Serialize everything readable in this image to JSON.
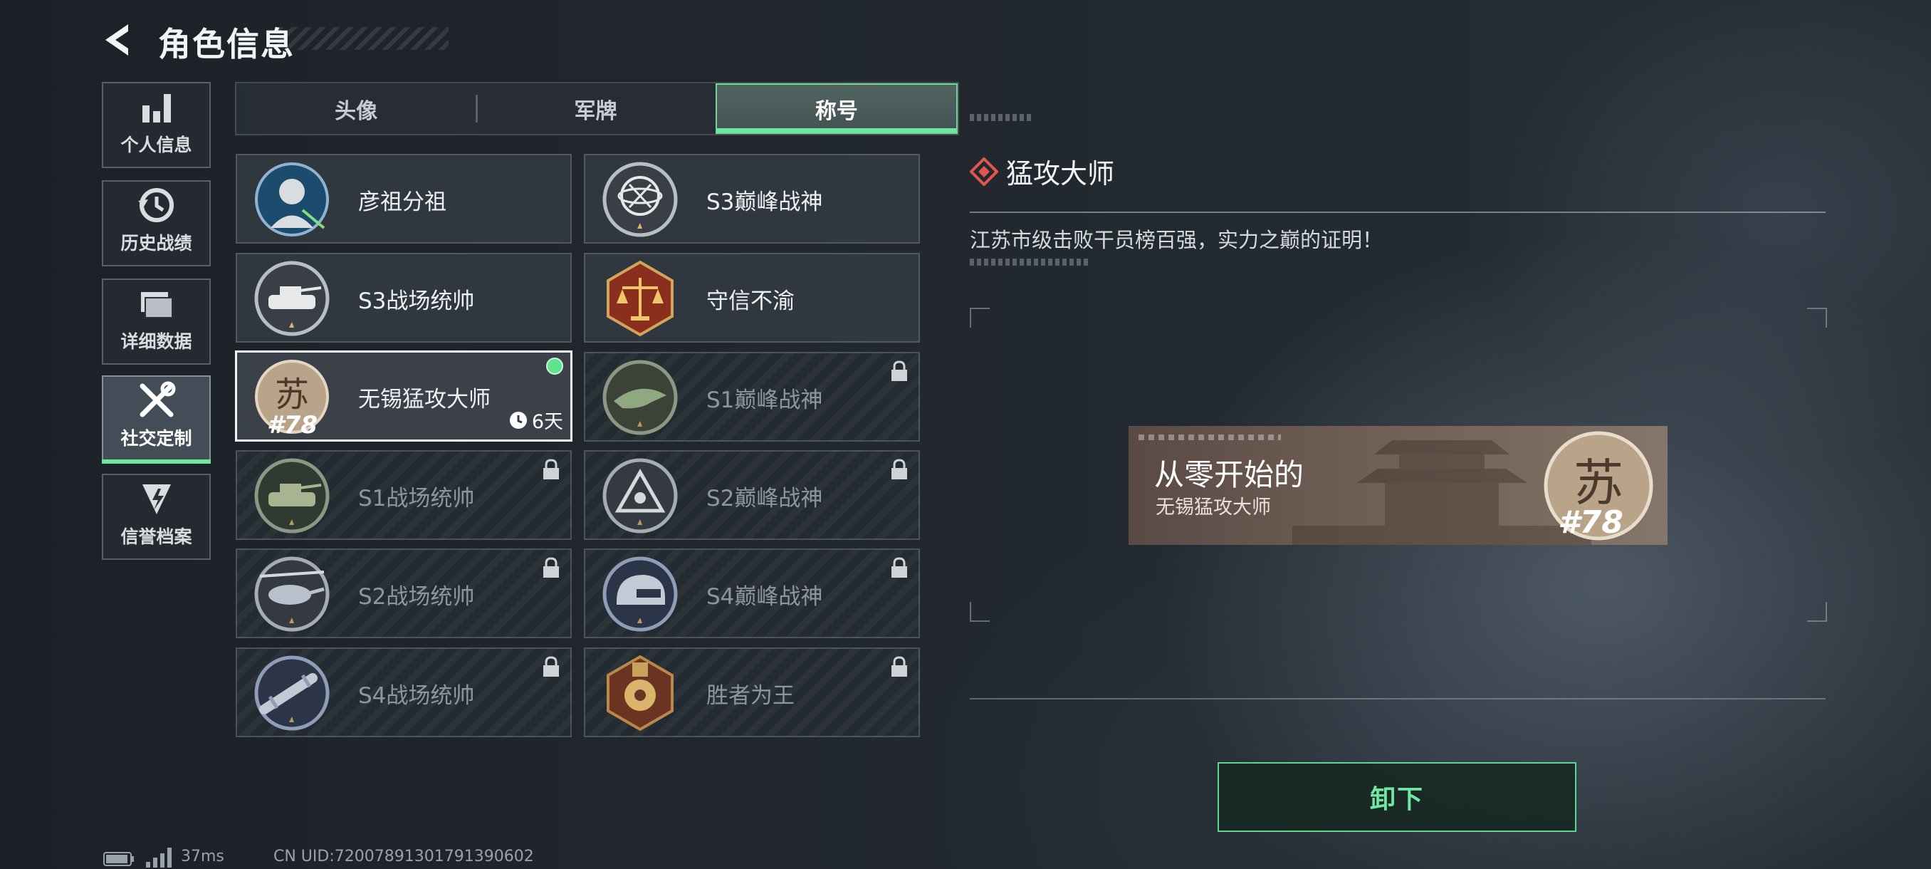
{
  "header": {
    "title": "角色信息"
  },
  "nav": {
    "items": [
      {
        "label": "个人信息",
        "icon": "bar-chart-icon"
      },
      {
        "label": "历史战绩",
        "icon": "history-icon"
      },
      {
        "label": "详细数据",
        "icon": "folder-icon"
      },
      {
        "label": "社交定制",
        "icon": "tools-icon",
        "active": true
      },
      {
        "label": "信誉档案",
        "icon": "shield-bolt-icon"
      }
    ]
  },
  "tabs": [
    {
      "label": "头像"
    },
    {
      "label": "军牌"
    },
    {
      "label": "称号",
      "active": true
    }
  ],
  "titles": [
    {
      "label": "彦祖分祖",
      "icon": "portrait-badge-icon",
      "locked": false
    },
    {
      "label": "S3巅峰战神",
      "icon": "armillary-badge-icon",
      "locked": false
    },
    {
      "label": "S3战场统帅",
      "icon": "tank-badge-icon",
      "locked": false
    },
    {
      "label": "守信不渝",
      "icon": "scales-badge-icon",
      "locked": false
    },
    {
      "label": "无锡猛攻大师",
      "icon": "su-badge-icon",
      "locked": false,
      "selected": true,
      "rank": "#78",
      "duration": "6天"
    },
    {
      "label": "S1巅峰战神",
      "icon": "crocodile-badge-icon",
      "locked": true
    },
    {
      "label": "S1战场统帅",
      "icon": "tank-badge-icon",
      "locked": true
    },
    {
      "label": "S2巅峰战神",
      "icon": "triangle-badge-icon",
      "locked": true
    },
    {
      "label": "S2战场统帅",
      "icon": "helicopter-badge-icon",
      "locked": true
    },
    {
      "label": "S4巅峰战神",
      "icon": "helmet-badge-icon",
      "locked": true
    },
    {
      "label": "S4战场统帅",
      "icon": "missile-badge-icon",
      "locked": true
    },
    {
      "label": "胜者为王",
      "icon": "medal-badge-icon",
      "locked": true
    }
  ],
  "detail": {
    "title": "猛攻大师",
    "description": "江苏市级击败干员榜百强，实力之巅的证明！",
    "preview": {
      "main_text": "从零开始的",
      "sub_text": "无锡猛攻大师",
      "rank": "#78"
    },
    "action_label": "卸下"
  },
  "footer": {
    "ping": "37ms",
    "uid": "CN UID:72007891301791390602"
  },
  "colors": {
    "accent": "#6fe7a1",
    "background": "#21272d",
    "locked_text": "#8e959c"
  }
}
